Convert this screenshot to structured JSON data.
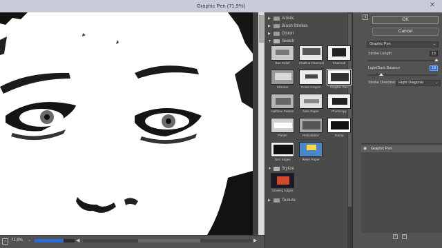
{
  "window": {
    "title": "Graphic Pen (71,9%)"
  },
  "statusbar": {
    "zoom": "71,9%",
    "progress": 0.72
  },
  "gallery": {
    "categories": [
      {
        "name": "Artistic",
        "open": false
      },
      {
        "name": "Brush Strokes",
        "open": false
      },
      {
        "name": "Distort",
        "open": false
      },
      {
        "name": "Sketch",
        "open": true
      },
      {
        "name": "Stylize",
        "open": true
      },
      {
        "name": "Texture",
        "open": false
      }
    ],
    "sketch_filters": [
      "Bas Relief",
      "Chalk & Charcoal",
      "Charcoal",
      "Chrome",
      "Conté Crayon",
      "Graphic Pen",
      "Halftone Pattern",
      "Note Paper",
      "Photocopy",
      "Plaster",
      "Reticulation",
      "Stamp",
      "Torn Edges",
      "Water Paper"
    ],
    "stylize_filters": [
      "Glowing Edges"
    ],
    "selected_filter": "Graphic Pen"
  },
  "panel": {
    "ok_label": "OK",
    "cancel_label": "Cancel",
    "filter_select": "Graphic Pen",
    "params": {
      "stroke_length_label": "Stroke Length",
      "stroke_length_value": "15",
      "light_dark_label": "Light/Dark Balance",
      "light_dark_value": "18",
      "stroke_direction_label": "Stroke Direction:",
      "stroke_direction_value": "Right Diagonal"
    },
    "layer_name": "Graphic Pen"
  },
  "colors": {
    "accent": "#2d6bd6",
    "panel_bg": "#535353",
    "gallery_bg": "#4a4a4a"
  }
}
